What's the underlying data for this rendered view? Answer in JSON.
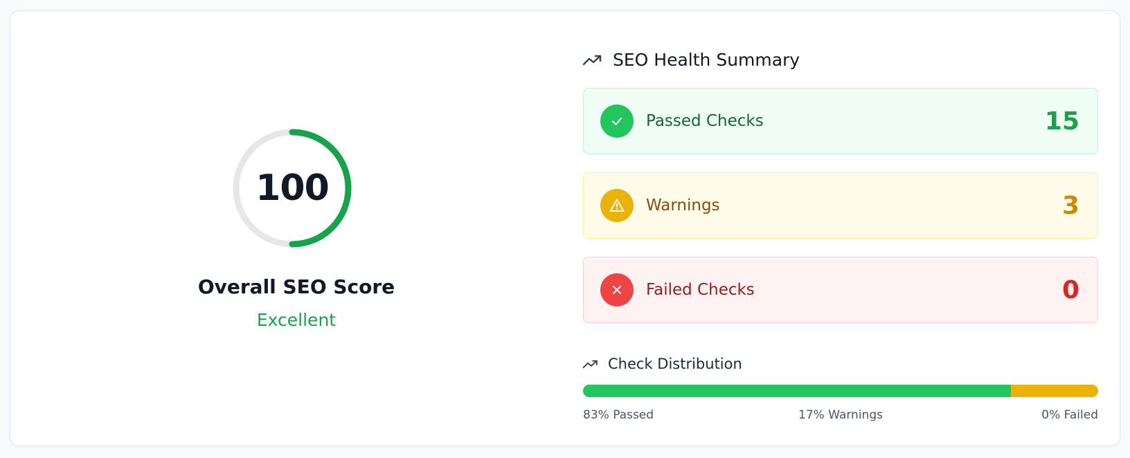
{
  "score": {
    "value": "100",
    "fraction": 0.5,
    "title": "Overall SEO Score",
    "rating": "Excellent",
    "color": "#16a34a",
    "track_color": "#e5e7eb"
  },
  "summary": {
    "title": "SEO Health Summary",
    "icon": "trending-up-icon",
    "stats": [
      {
        "label": "Passed Checks",
        "value": "15",
        "icon": "check-icon"
      },
      {
        "label": "Warnings",
        "value": "3",
        "icon": "warning-triangle-icon"
      },
      {
        "label": "Failed Checks",
        "value": "0",
        "icon": "x-icon"
      }
    ]
  },
  "distribution": {
    "title": "Check Distribution",
    "icon": "trending-up-icon",
    "segments": [
      {
        "name": "passed",
        "percent": 83,
        "color": "#22c55e"
      },
      {
        "name": "warnings",
        "percent": 17,
        "color": "#eab308"
      },
      {
        "name": "failed",
        "percent": 0,
        "color": "#ef4444"
      }
    ],
    "labels": {
      "passed": "83% Passed",
      "warnings": "17% Warnings",
      "failed": "0% Failed"
    }
  }
}
